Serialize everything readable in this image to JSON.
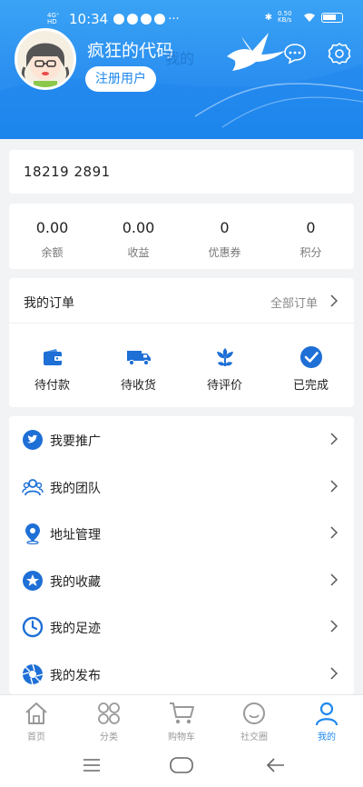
{
  "status_bar": {
    "network": "4G⁺ HD",
    "time": "10:34",
    "speed": "0.50 KB/s",
    "battery": "battery"
  },
  "header": {
    "username": "疯狂的代码",
    "register_label": "注册用户",
    "page_title": "我的",
    "message_icon": "chat-bubble-icon",
    "settings_icon": "gear-icon"
  },
  "account": {
    "phone": "18219  2891"
  },
  "stats": [
    {
      "value": "0.00",
      "label": "余额"
    },
    {
      "value": "0.00",
      "label": "收益"
    },
    {
      "value": "0",
      "label": "优惠券"
    },
    {
      "value": "0",
      "label": "积分"
    }
  ],
  "orders": {
    "title": "我的订单",
    "all_label": "全部订单",
    "items": [
      {
        "label": "待付款",
        "icon": "wallet-icon"
      },
      {
        "label": "待收货",
        "icon": "truck-icon"
      },
      {
        "label": "待评价",
        "icon": "flower-icon"
      },
      {
        "label": "已完成",
        "icon": "check-circle-icon"
      }
    ]
  },
  "menu": [
    {
      "label": "我要推广",
      "icon": "twitter-bird-icon"
    },
    {
      "label": "我的团队",
      "icon": "team-icon"
    },
    {
      "label": "地址管理",
      "icon": "location-pin-icon"
    },
    {
      "label": "我的收藏",
      "icon": "star-icon"
    },
    {
      "label": "我的足迹",
      "icon": "clock-icon"
    },
    {
      "label": "我的发布",
      "icon": "aperture-icon"
    }
  ],
  "tabs": [
    {
      "label": "首页",
      "icon": "home-icon",
      "active": false
    },
    {
      "label": "分类",
      "icon": "category-icon",
      "active": false
    },
    {
      "label": "购物车",
      "icon": "cart-icon",
      "active": false
    },
    {
      "label": "社交圈",
      "icon": "social-icon",
      "active": false
    },
    {
      "label": "我的",
      "icon": "profile-icon",
      "active": true
    }
  ],
  "colors": {
    "accent": "#1e88ee",
    "header_top": "#3aa3f5",
    "background": "#f2f3f5"
  }
}
